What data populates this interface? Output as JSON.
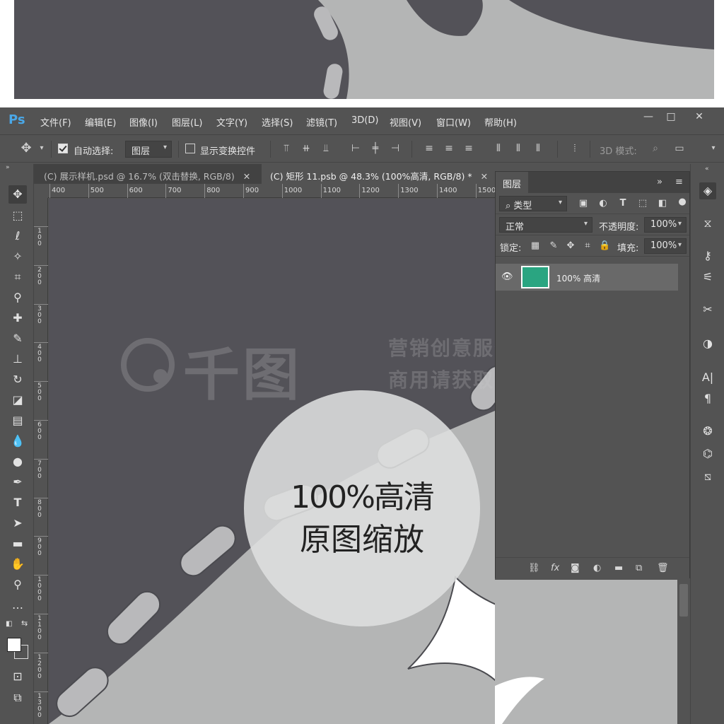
{
  "app": {
    "logo": "Ps"
  },
  "menu": [
    "文件(F)",
    "编辑(E)",
    "图像(I)",
    "图层(L)",
    "文字(Y)",
    "选择(S)",
    "滤镜(T)",
    "3D(D)",
    "视图(V)",
    "窗口(W)",
    "帮助(H)"
  ],
  "window_controls": {
    "minimize": "—",
    "maximize": "□",
    "close": "✕"
  },
  "options": {
    "auto_select_label": "自动选择:",
    "auto_select_target": "图层",
    "show_transform_label": "显示变换控件",
    "mode_3d_label": "3D 模式:"
  },
  "tabs": [
    {
      "label": "(C) 展示样机.psd @ 16.7% (双击替换, RGB/8)",
      "close": "✕"
    },
    {
      "label": "(C) 矩形 11.psb @ 48.3% (100%高清, RGB/8) *",
      "close": "✕"
    }
  ],
  "ruler": {
    "horizontal": [
      "400",
      "500",
      "600",
      "700",
      "800",
      "900",
      "1000",
      "1100",
      "1200",
      "1300",
      "1400",
      "1500"
    ],
    "vertical": [
      "100",
      "200",
      "300",
      "400",
      "500",
      "600",
      "700",
      "800",
      "900",
      "1000",
      "1100",
      "1200",
      "1300"
    ]
  },
  "watermark": {
    "logo": "千图",
    "line1": "营销创意服务与协作平台",
    "line2": "商用请获取授权"
  },
  "zoom_badge": {
    "line1": "100%高清",
    "line2": "原图缩放"
  },
  "layers_panel": {
    "title": "图层",
    "filter_type": "类型",
    "blend_mode": "正常",
    "opacity_label": "不透明度:",
    "opacity_value": "100%",
    "lock_label": "锁定:",
    "fill_label": "填充:",
    "fill_value": "100%",
    "layers": [
      {
        "name": "100% 高清",
        "thumb_color": "#2aa581"
      }
    ]
  },
  "colors": {
    "ui_bg": "#535353",
    "canvas_dark": "#535258",
    "canvas_light": "#b4b5b5",
    "dash": "#b9b9bb",
    "accent_blue": "#4aa8e8",
    "layer_thumb": "#2aa581"
  }
}
